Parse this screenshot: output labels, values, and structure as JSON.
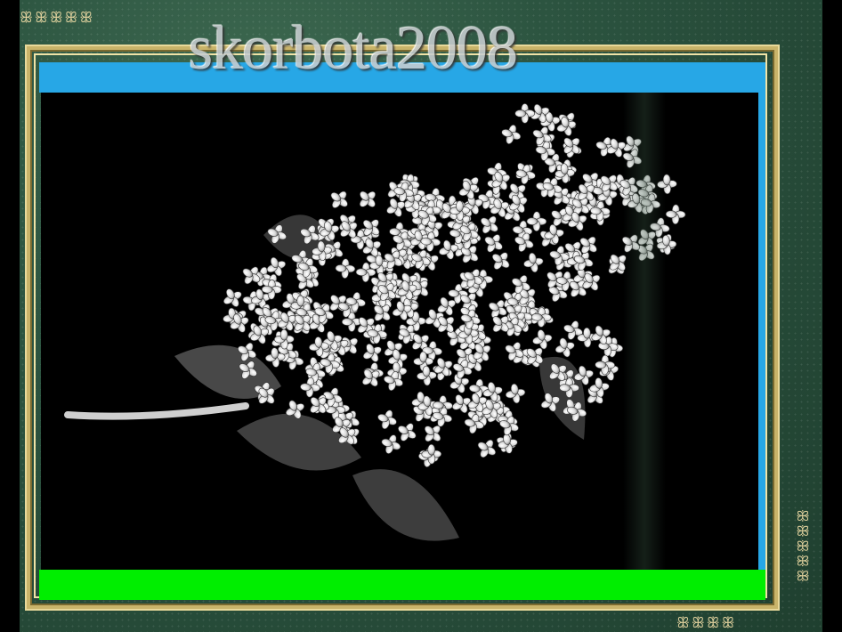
{
  "watermark": {
    "text": "skorbota2008"
  },
  "ornaments": {
    "top_left": "ꕥꕥꕥꕥꕥ",
    "bottom_right": "ꕥꕥꕥꕥꕥ",
    "bottom": "ꕥꕥꕥꕥ"
  },
  "image": {
    "subject": "lilac-blossom",
    "icon": "flower-icon"
  },
  "colors": {
    "blue_band": "#27a7e6",
    "green_band": "#00ee00",
    "frame": "#2c5440",
    "gold": "#c9b46a"
  }
}
